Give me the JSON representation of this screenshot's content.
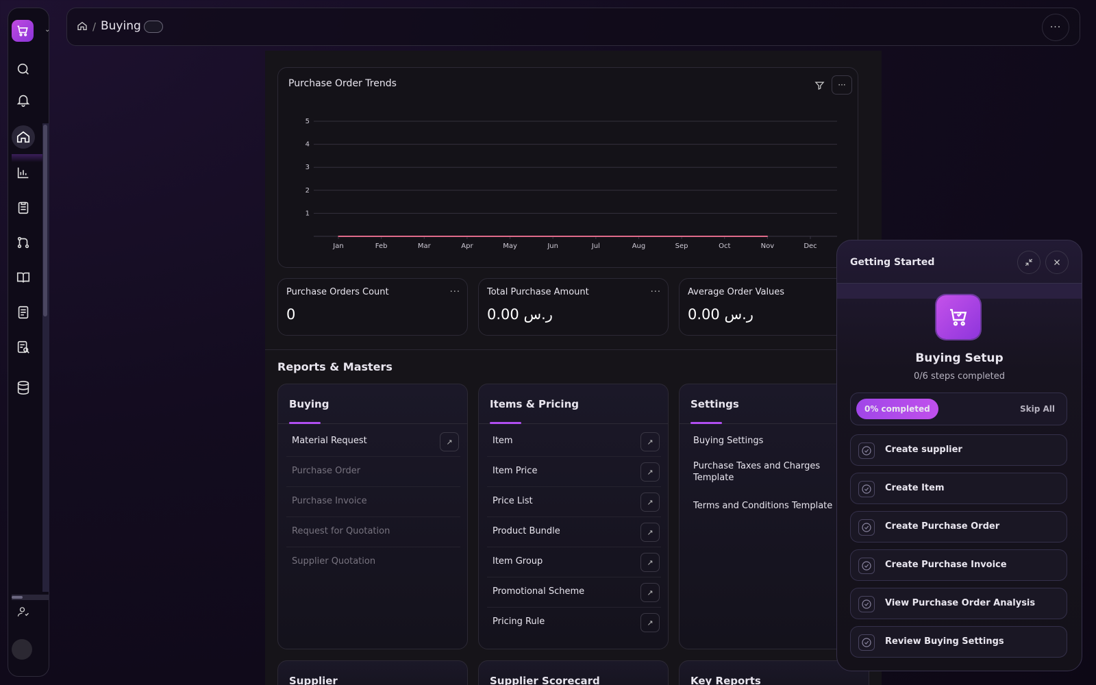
{
  "breadcrumb": {
    "current": "Buying"
  },
  "chart": {
    "title": "Purchase Order Trends",
    "chart_data": {
      "type": "line",
      "title": "Purchase Order Trends",
      "categories": [
        "Jan",
        "Feb",
        "Mar",
        "Apr",
        "May",
        "Jun",
        "Jul",
        "Aug",
        "Sep",
        "Oct",
        "Nov",
        "Dec"
      ],
      "series": [
        {
          "values": [
            0,
            0,
            0,
            0,
            0,
            0,
            0,
            0,
            0,
            0,
            0,
            null
          ]
        }
      ],
      "yticks": [
        1,
        2,
        3,
        4,
        5
      ],
      "ylim": [
        0,
        5
      ],
      "grid": true,
      "line_color": "#e06b8a"
    }
  },
  "stats": [
    {
      "label": "Purchase Orders Count",
      "value": "0"
    },
    {
      "label": "Total Purchase Amount",
      "value": "0.00 ر.س"
    },
    {
      "label": "Average Order Values",
      "value": "0.00 ر.س"
    }
  ],
  "reports": {
    "title": "Reports & Masters",
    "groups": [
      {
        "title": "Buying",
        "items": [
          "Material Request",
          "Purchase Order",
          "Purchase Invoice",
          "Request for Quotation",
          "Supplier Quotation"
        ]
      },
      {
        "title": "Items & Pricing",
        "items": [
          "Item",
          "Item Price",
          "Price List",
          "Product Bundle",
          "Item Group",
          "Promotional Scheme",
          "Pricing Rule"
        ]
      },
      {
        "title": "Settings",
        "items": [
          "Buying Settings",
          "Purchase Taxes and Charges Template",
          "Terms and Conditions Template"
        ]
      }
    ],
    "bottom": [
      "Supplier",
      "Supplier Scorecard",
      "Key Reports"
    ]
  },
  "getting_started": {
    "title": "Getting Started",
    "heading": "Buying Setup",
    "subtitle": "0/6 steps completed",
    "progress_label": "0% completed",
    "progress": 0,
    "skip_label": "Skip All",
    "steps": [
      "Create supplier",
      "Create Item",
      "Create Purchase Order",
      "Create Purchase Invoice",
      "View Purchase Order Analysis",
      "Review Buying Settings"
    ]
  },
  "colors": {
    "accent": "#b04ef0",
    "brand": "#c04ae0"
  }
}
